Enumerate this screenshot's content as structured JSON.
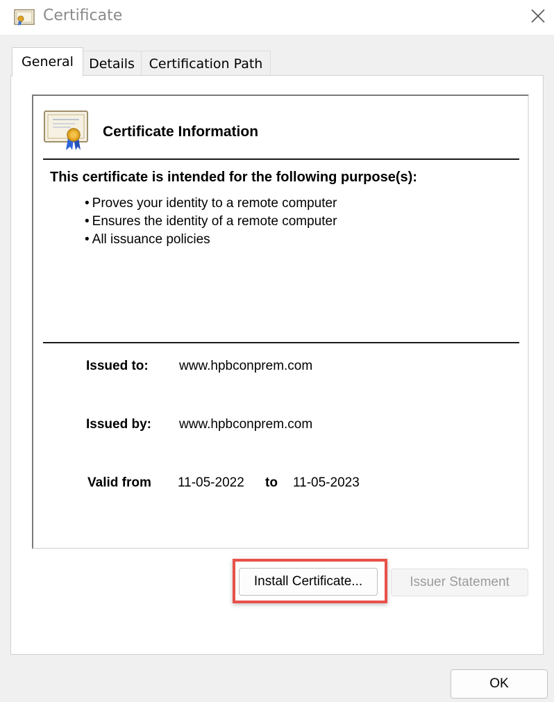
{
  "window": {
    "title": "Certificate",
    "close_label": "close-icon"
  },
  "tabs": [
    {
      "label": "General",
      "active": true
    },
    {
      "label": "Details",
      "active": false
    },
    {
      "label": "Certification Path",
      "active": false
    }
  ],
  "info": {
    "heading": "Certificate Information",
    "purpose_heading": "This certificate is intended for the following purpose(s):",
    "purposes": [
      "Proves your identity to a remote computer",
      "Ensures the identity of a remote computer",
      "All issuance policies"
    ],
    "issued_to_label": "Issued to:",
    "issued_to": "www.hpbconprem.com",
    "issued_by_label": "Issued by:",
    "issued_by": "www.hpbconprem.com",
    "valid_from_label": "Valid from",
    "valid_from": "11-05-2022",
    "valid_to_label": "to",
    "valid_to": "11-05-2023"
  },
  "buttons": {
    "install": "Install Certificate...",
    "issuer_statement": "Issuer Statement",
    "ok": "OK"
  },
  "colors": {
    "highlight": "#e8514a",
    "disabled_text": "#9b9b9b",
    "title_text": "#8a8a8a"
  }
}
